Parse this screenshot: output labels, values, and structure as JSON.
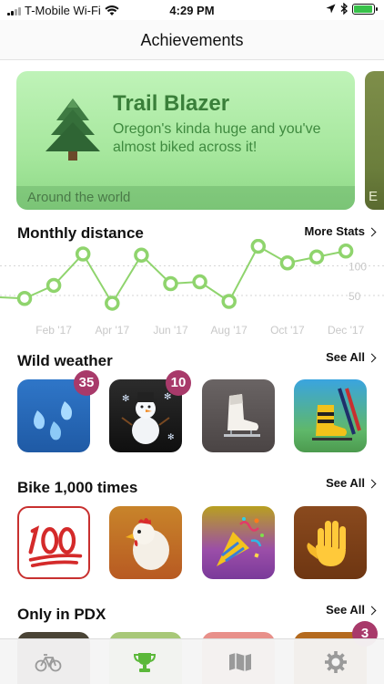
{
  "status": {
    "carrier": "T-Mobile Wi-Fi",
    "time": "4:29 PM",
    "battery_level": 0.95
  },
  "nav": {
    "title": "Achievements"
  },
  "hero": {
    "title": "Trail Blazer",
    "subtitle": "Oregon's kinda huge and you've almost biked across it!",
    "footer_label": "Around the world",
    "next_card_peek": "E",
    "icon": "pine-tree-icon",
    "colors": {
      "bg": "#b4eeac",
      "title": "#3a7f3a"
    }
  },
  "monthly": {
    "title": "Monthly distance",
    "link": "More Stats"
  },
  "chart_data": {
    "type": "line",
    "x_tick_labels": [
      "Feb '17",
      "Apr '17",
      "Jun '17",
      "Aug '17",
      "Oct '17",
      "Dec '17"
    ],
    "y_tick_labels": [
      "100",
      "50"
    ],
    "y_ticks": [
      100,
      50
    ],
    "ylim": [
      10,
      130
    ],
    "grid": "dashed horizontal",
    "series": [
      {
        "color": "#8fd46d",
        "x": [
          "Jan '17",
          "Feb '17",
          "Mar '17",
          "Apr '17",
          "May '17",
          "Jun '17",
          "Jul '17",
          "Aug '17",
          "Sep '17",
          "Oct '17",
          "Nov '17",
          "Dec '17",
          "Jan '18"
        ],
        "values": [
          45,
          67,
          120,
          37,
          118,
          70,
          73,
          40,
          133,
          105,
          115,
          125,
          null
        ]
      }
    ],
    "pre_range_value": 47
  },
  "sections": {
    "wild_weather": {
      "title": "Wild weather",
      "link": "See All",
      "badges": [
        "35",
        "10"
      ],
      "icons": [
        "sweat-droplets-icon",
        "snowman-icon",
        "ice-skate-icon",
        "ski-boot-icon"
      ]
    },
    "bike_1000": {
      "title": "Bike 1,000 times",
      "link": "See All",
      "icons": [
        "hundred-points-icon",
        "chicken-icon",
        "party-popper-icon",
        "raised-hand-icon"
      ]
    },
    "only_pdx": {
      "title": "Only in PDX",
      "link": "See All",
      "badges": [
        "3"
      ]
    }
  },
  "tab_bar": {
    "active": "achievements",
    "tabs": [
      "bike-icon",
      "trophy-icon",
      "map-icon",
      "gear-icon"
    ],
    "active_color": "#5bb83a"
  }
}
